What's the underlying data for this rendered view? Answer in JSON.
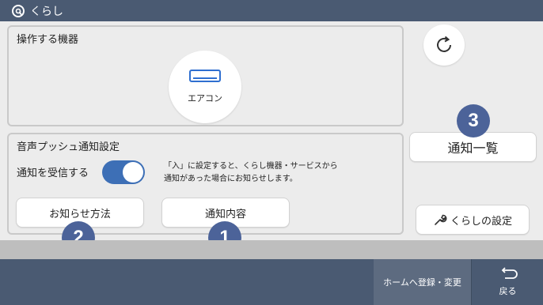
{
  "app": {
    "title": "くらし"
  },
  "device_panel": {
    "title": "操作する機器",
    "device_label": "エアコン"
  },
  "voice_panel": {
    "title": "音声プッシュ通知設定",
    "receive_label": "通知を受信する",
    "receive_enabled": true,
    "description_line1": "「入」に設定すると、くらし機器・サービスから",
    "description_line2": "通知があった場合にお知らせします。",
    "notify_method_button": "お知らせ方法",
    "notify_content_button": "通知内容"
  },
  "side": {
    "notification_list_button": "通知一覧",
    "kurashi_settings_button": "くらしの設定"
  },
  "badges": [
    "1",
    "2",
    "3"
  ],
  "footer": {
    "register_button": "ホームへ登録・変更",
    "back_button": "戻る"
  },
  "colors": {
    "header": "#4a5a72",
    "accent": "#3d6fb6",
    "badge": "#4c6399"
  }
}
